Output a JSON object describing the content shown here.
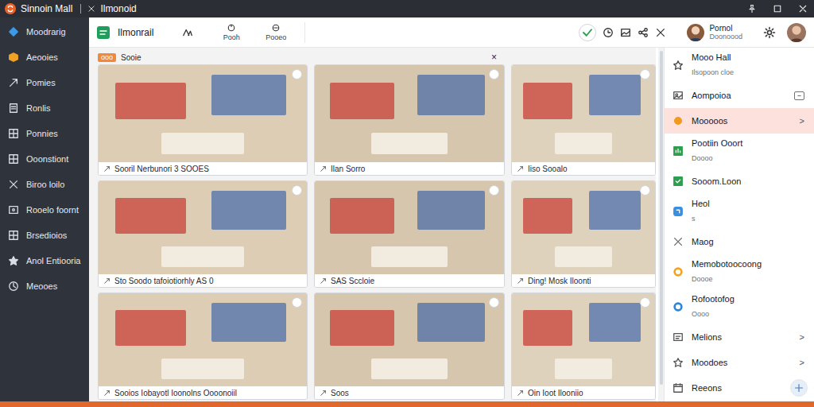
{
  "window": {
    "title": "Sinnoin Mall",
    "tab": "Ilmonoid"
  },
  "sidebar": {
    "items": [
      {
        "label": "Moodrarig",
        "color": "#3b9be8"
      },
      {
        "label": "Aeooies",
        "color": "#f0a323"
      },
      {
        "label": "Pomies",
        "color": "#d8dde6"
      },
      {
        "label": "Ronlis",
        "color": "#d8dde6"
      },
      {
        "label": "Ponnies",
        "color": "#d8dde6"
      },
      {
        "label": "Ooonstiont",
        "color": "#d8dde6"
      },
      {
        "label": "Biroo loilo",
        "color": "#d8dde6"
      },
      {
        "label": "Rooelo foornt",
        "color": "#d8dde6"
      },
      {
        "label": "Brsedioios",
        "color": "#d8dde6"
      },
      {
        "label": "Anol Entiooria",
        "color": "#d8dde6"
      },
      {
        "label": "Meooes",
        "color": "#d8dde6"
      }
    ]
  },
  "toolbar": {
    "app": "Ilmonrail",
    "tools": [
      {
        "label": "Pooh"
      },
      {
        "label": "Pooeo"
      }
    ],
    "user": {
      "name": "Pornol",
      "role": "Doonoood"
    }
  },
  "gallery": {
    "badge": "ooo",
    "title": "Sooie",
    "close": "×",
    "cards": [
      {
        "caption": "Sooril Nerbunori 3 SOOES",
        "checked": false
      },
      {
        "caption": "Ilan Sorro",
        "checked": false
      },
      {
        "caption": "Iiso Sooalo",
        "checked": false
      },
      {
        "caption": "Sto Soodo tafoiotiorhly AS 0",
        "checked": false
      },
      {
        "caption": "SAS Sccloie",
        "checked": false
      },
      {
        "caption": "Ding! Mosk Iloonti",
        "checked": false
      },
      {
        "caption": "Sooios Iobayotl Ioonolns Oooonoiil",
        "checked": false
      },
      {
        "caption": "Soos",
        "checked": false
      },
      {
        "caption": "Oin Ioot Ilooniio",
        "checked": false
      }
    ]
  },
  "panel": {
    "items": [
      {
        "title": "Mooo Hall",
        "subtitle": "Ilsopoon cloe",
        "selected": false,
        "color": "#444444"
      },
      {
        "title": "Aompoioa",
        "selected": false,
        "color": "#555555"
      },
      {
        "title": "Mooooos",
        "selected": true,
        "color": "#f29a1f",
        "trail": ">"
      },
      {
        "title": "Pootiin Ooort",
        "subtitle": "Doooo",
        "selected": false,
        "color": "#2e9e4f"
      },
      {
        "title": "Sooom.Loon",
        "selected": false,
        "color": "#2e9e4f"
      },
      {
        "title": "Heol",
        "subtitle": "s",
        "selected": false,
        "color": "#3a8fe0"
      },
      {
        "title": "Maog",
        "selected": false,
        "color": "#666666"
      },
      {
        "title": "Memobotoocoong",
        "subtitle": "Doooe",
        "selected": false,
        "color": "#f2a41f"
      },
      {
        "title": "Rofootofog",
        "subtitle": "Oooo",
        "selected": false,
        "color": "#2a86d8"
      },
      {
        "title": "Melions",
        "selected": false,
        "color": "#555555",
        "trail": ">"
      },
      {
        "title": "Moodoes",
        "selected": false,
        "color": "#555555",
        "trail": ">"
      },
      {
        "title": "Reeons",
        "selected": false,
        "color": "#555555"
      }
    ]
  }
}
